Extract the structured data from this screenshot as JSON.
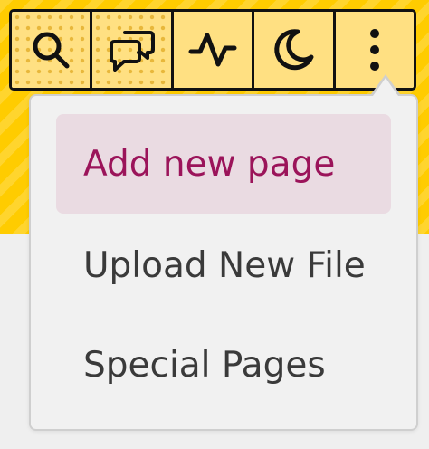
{
  "toolbar": {
    "buttons": [
      {
        "icon": "search-icon",
        "label": "Search"
      },
      {
        "icon": "chat-bubble-icon",
        "label": "Talk"
      },
      {
        "icon": "activity-icon",
        "label": "Recent changes"
      },
      {
        "icon": "moon-icon",
        "label": "Dark mode"
      },
      {
        "icon": "more-vertical-icon",
        "label": "More"
      }
    ]
  },
  "menu": {
    "items": [
      {
        "label": "Add new page",
        "active": true
      },
      {
        "label": "Upload New File",
        "active": false
      },
      {
        "label": "Special Pages",
        "active": false
      }
    ]
  },
  "colors": {
    "background_accent": "#ffcc00",
    "toolbar_fill": "#ffe082",
    "active_item_bg": "#eadbe2",
    "active_item_text": "#9b145a",
    "item_text": "#3a3a3a"
  }
}
